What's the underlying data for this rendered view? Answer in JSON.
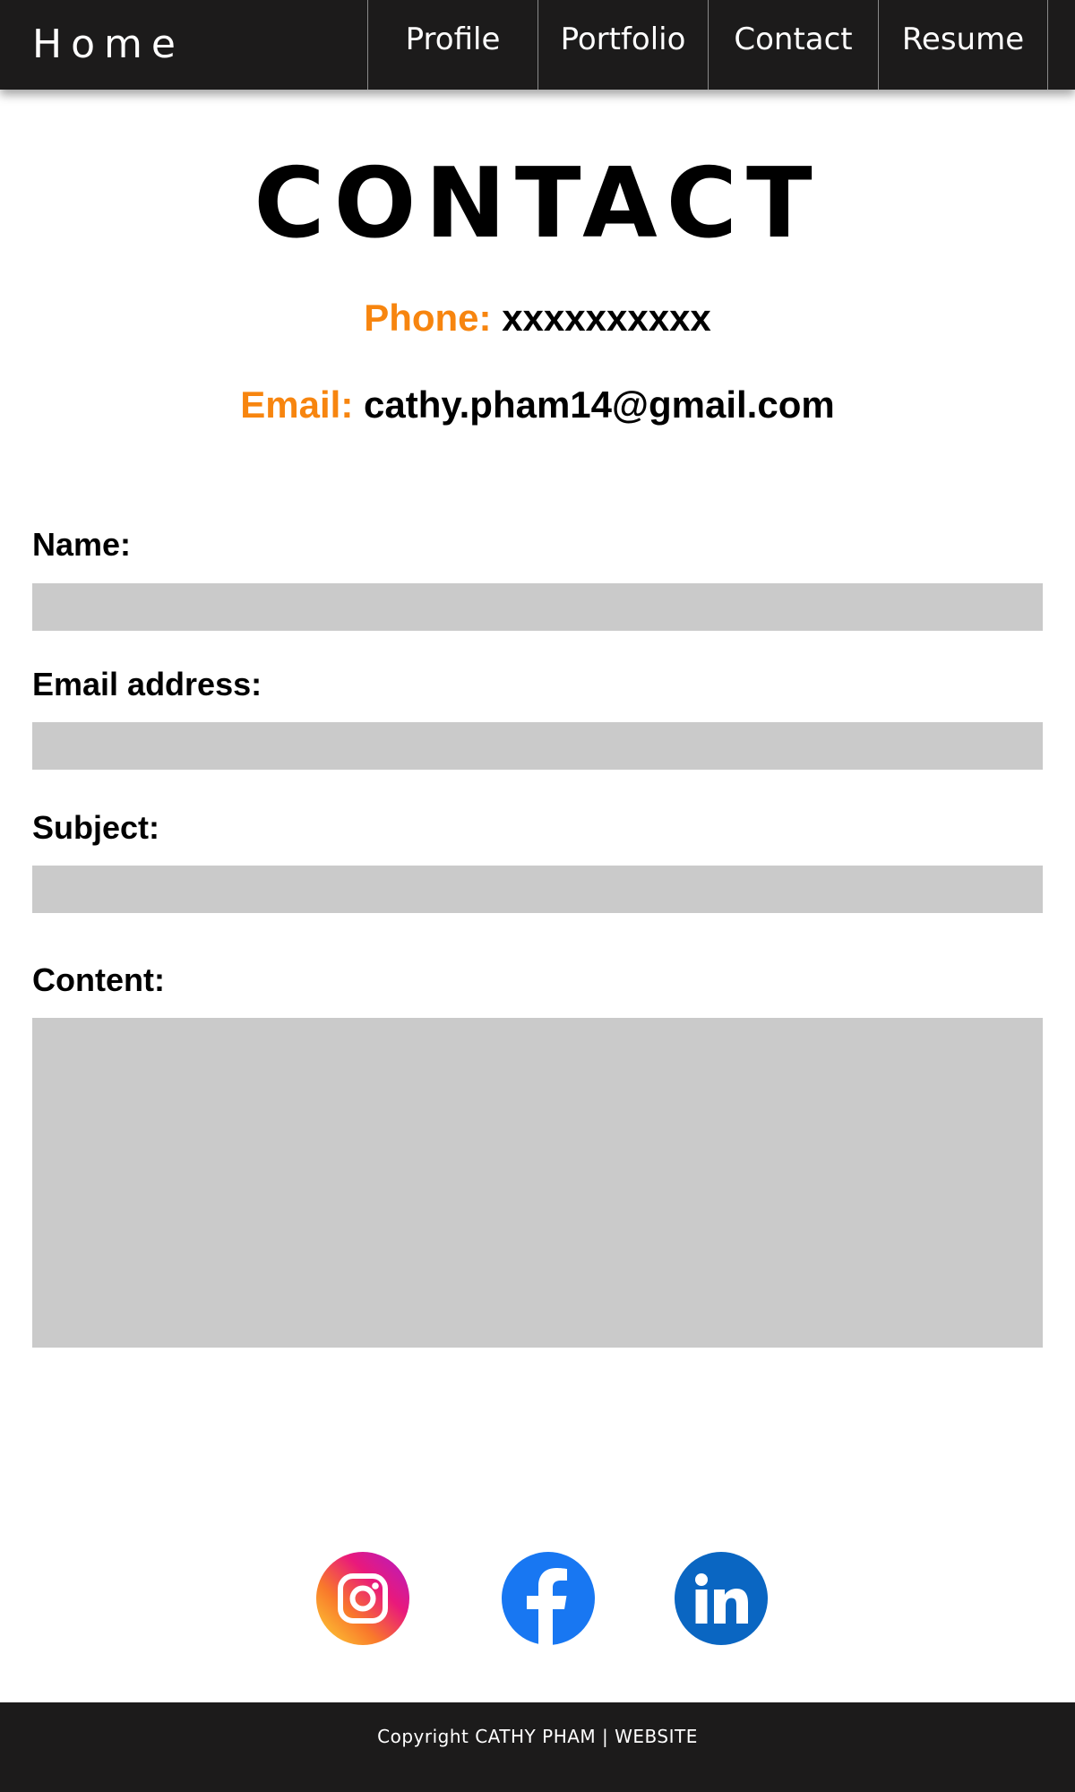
{
  "nav": {
    "brand": "Home",
    "items": [
      {
        "label": "Profile"
      },
      {
        "label": "Portfolio"
      },
      {
        "label": "Contact"
      },
      {
        "label": "Resume"
      }
    ]
  },
  "page": {
    "title": "CONTACT",
    "phone_label": "Phone:",
    "phone_value": "xxxxxxxxxx",
    "email_label": "Email:",
    "email_value": "cathy.pham14@gmail.com"
  },
  "form": {
    "name_label": "Name:",
    "name_value": "",
    "email_label": "Email address:",
    "email_value": "",
    "subject_label": "Subject:",
    "subject_value": "",
    "content_label": "Content:",
    "content_value": ""
  },
  "social": {
    "icons": [
      "instagram-icon",
      "facebook-icon",
      "linkedin-icon"
    ]
  },
  "footer": {
    "copyright": "Copyright CATHY PHAM | WEBSITE"
  },
  "colors": {
    "accent": "#f7850f",
    "nav_background": "#1c1b1b",
    "input_background": "#cacaca",
    "facebook_blue": "#1877f2",
    "linkedin_blue": "#0a66c2"
  }
}
